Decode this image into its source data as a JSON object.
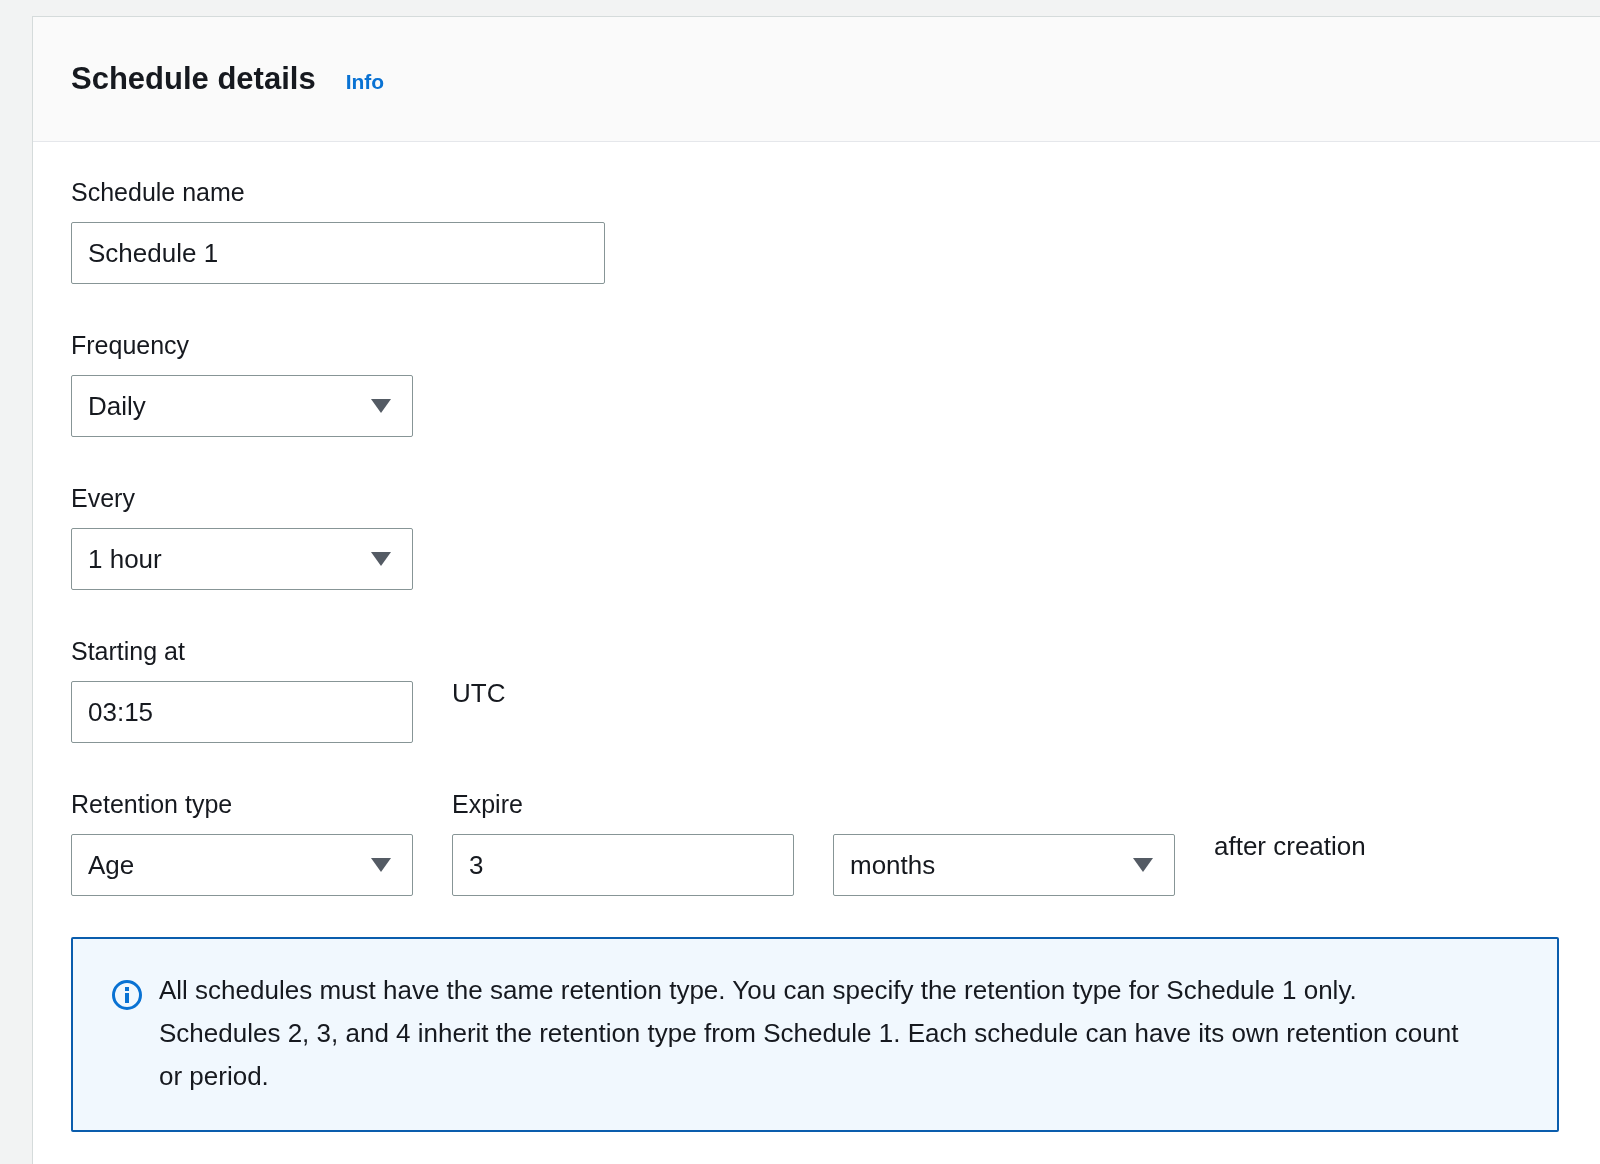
{
  "panel": {
    "title": "Schedule details",
    "info_link": "Info"
  },
  "groups": [
    {
      "fields": [
        {
          "kind": "text",
          "label": "Schedule name",
          "value": "Schedule 1"
        }
      ]
    },
    {
      "fields": [
        {
          "kind": "select",
          "label": "Frequency",
          "value": "Daily"
        }
      ]
    },
    {
      "fields": [
        {
          "kind": "select",
          "label": "Every",
          "value": "1 hour"
        }
      ]
    },
    {
      "fields": [
        {
          "kind": "text",
          "label": "Starting at",
          "value": "03:15"
        }
      ],
      "suffix": "UTC"
    },
    {
      "fields": [
        {
          "kind": "select",
          "label": "Retention type",
          "value": "Age"
        },
        {
          "kind": "text",
          "label": "Expire",
          "value": "3"
        },
        {
          "kind": "select",
          "value": "months"
        }
      ],
      "suffix": "after creation"
    }
  ],
  "alert": {
    "text": "All schedules must have the same retention type. You can specify the retention type for Schedule 1 only. Schedules 2, 3, and 4 inherit the retention type from Schedule 1. Each schedule can have its own retention count or period."
  }
}
